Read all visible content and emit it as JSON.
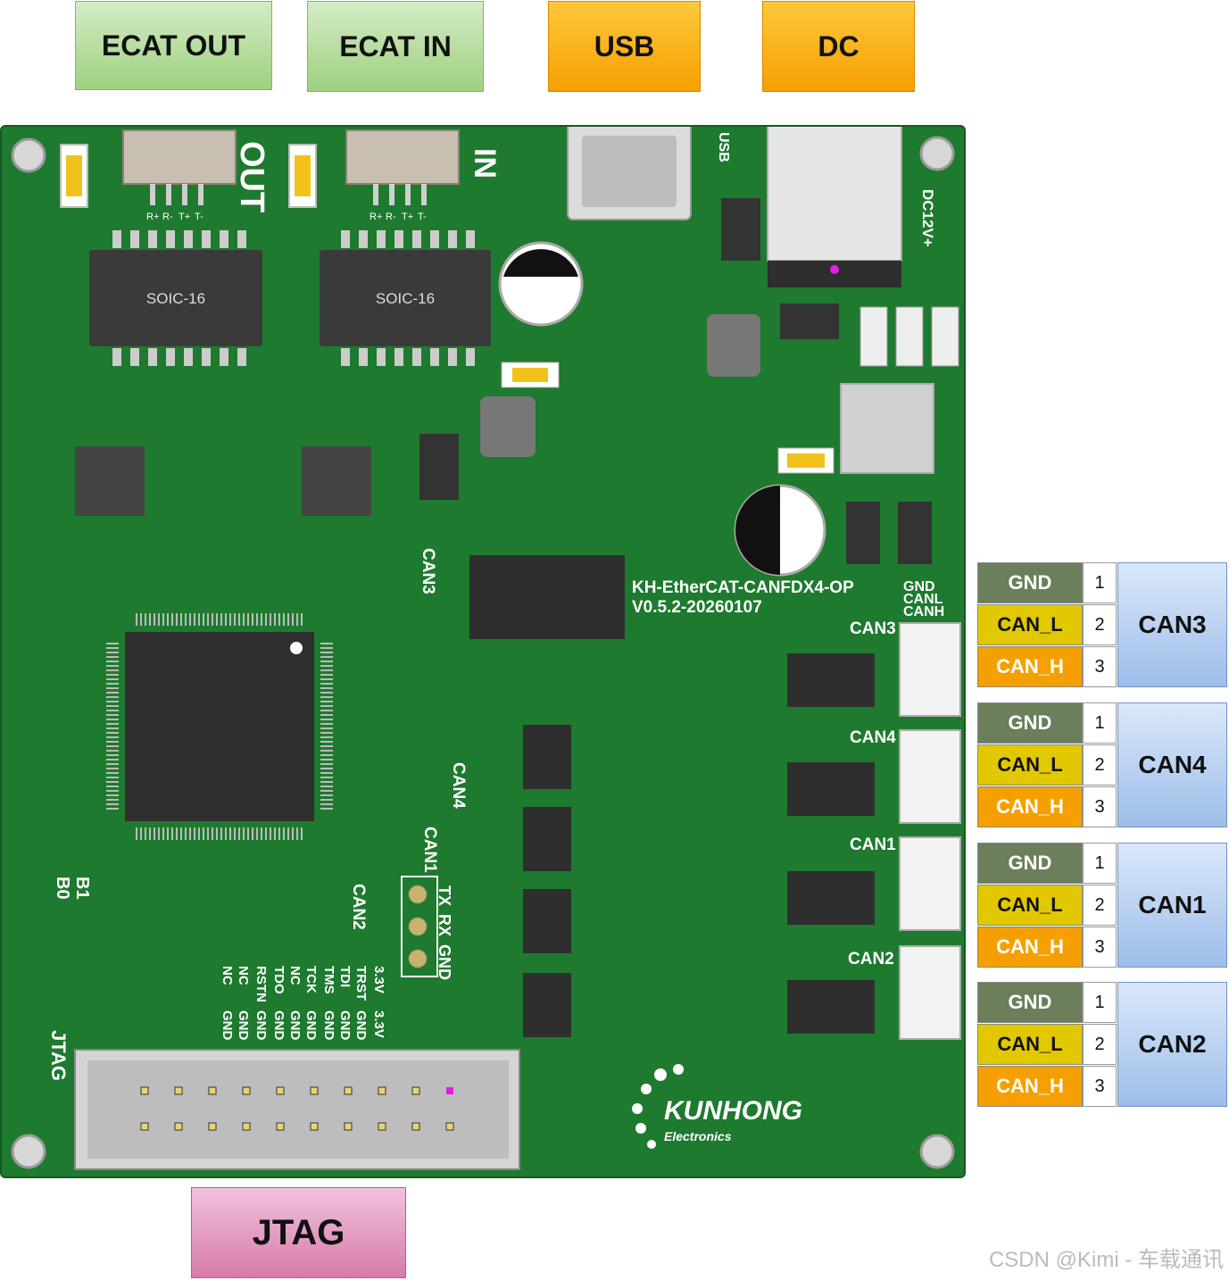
{
  "top_labels": {
    "ecat_out": "ECAT OUT",
    "ecat_in": "ECAT IN",
    "usb": "USB",
    "dc": "DC"
  },
  "bottom_label": {
    "jtag": "JTAG"
  },
  "board": {
    "silk_out": "OUT",
    "silk_in": "IN",
    "silk_usb": "USB",
    "silk_dc": "DC12V+",
    "chip_label_1": "SOIC-16",
    "chip_label_2": "SOIC-16",
    "rj45_pins_1": [
      "R+",
      "R-",
      "T+",
      "T-"
    ],
    "rj45_pins_2": [
      "R+",
      "R-",
      "T+",
      "T-"
    ],
    "model_line_1": "KH-EtherCAT-CANFDX4-OP",
    "model_line_2": "V0.5.2-20260107",
    "header_gnd": "GND",
    "header_canl": "CANL",
    "header_canh": "CANH",
    "can_silk": [
      "CAN3",
      "CAN4",
      "CAN1",
      "CAN2"
    ],
    "side_can3": "CAN3",
    "side_can4": "CAN4",
    "side_can1": "CAN1",
    "side_can2": "CAN2",
    "uart_pins": [
      "TX",
      "RX",
      "GND"
    ],
    "boot_b1": "B1",
    "boot_b0": "B0",
    "jtag_silk": "JTAG",
    "jtag_pins_row1": [
      "NC",
      "NC",
      "RSTN",
      "TDO",
      "NC",
      "TCK",
      "TMS",
      "TDI",
      "TRST",
      "3.3V"
    ],
    "jtag_pins_row2": [
      "GND",
      "GND",
      "GND",
      "GND",
      "GND",
      "GND",
      "GND",
      "GND",
      "GND",
      "3.3V"
    ],
    "logo_name": "KUNHONG",
    "logo_sub": "Electronics"
  },
  "pinouts": [
    {
      "name": "CAN3",
      "pins": [
        {
          "label": "GND",
          "num": "1"
        },
        {
          "label": "CAN_L",
          "num": "2"
        },
        {
          "label": "CAN_H",
          "num": "3"
        }
      ]
    },
    {
      "name": "CAN4",
      "pins": [
        {
          "label": "GND",
          "num": "1"
        },
        {
          "label": "CAN_L",
          "num": "2"
        },
        {
          "label": "CAN_H",
          "num": "3"
        }
      ]
    },
    {
      "name": "CAN1",
      "pins": [
        {
          "label": "GND",
          "num": "1"
        },
        {
          "label": "CAN_L",
          "num": "2"
        },
        {
          "label": "CAN_H",
          "num": "3"
        }
      ]
    },
    {
      "name": "CAN2",
      "pins": [
        {
          "label": "GND",
          "num": "1"
        },
        {
          "label": "CAN_L",
          "num": "2"
        },
        {
          "label": "CAN_H",
          "num": "3"
        }
      ]
    }
  ],
  "watermark": "CSDN @Kimi - 车载通讯"
}
